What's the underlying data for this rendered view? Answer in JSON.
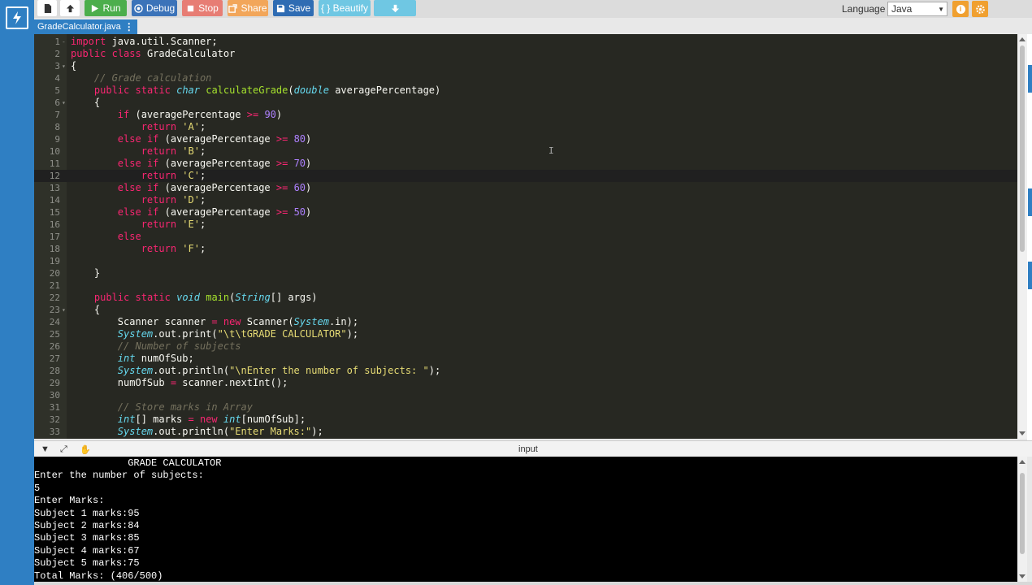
{
  "toolbar": {
    "run_label": "Run",
    "debug_label": "Debug",
    "stop_label": "Stop",
    "share_label": "Share",
    "save_label": "Save",
    "beautify_label": "{ } Beautify",
    "language_label": "Language",
    "language_value": "Java"
  },
  "tab": {
    "filename": "GradeCalculator.java"
  },
  "editor": {
    "active_line": 12,
    "lines": [
      [
        [
          "kw",
          "import"
        ],
        [
          "",
          "java.util.Scanner;"
        ]
      ],
      [
        [
          "kw",
          "public"
        ],
        [
          "",
          ""
        ],
        [
          "kw",
          "class"
        ],
        [
          "",
          " GradeCalculator"
        ]
      ],
      [
        [
          "",
          "{"
        ]
      ],
      [
        [
          "",
          "    "
        ],
        [
          "cm",
          "// Grade calculation"
        ]
      ],
      [
        [
          "",
          "    "
        ],
        [
          "kw",
          "public"
        ],
        [
          "",
          " "
        ],
        [
          "kw",
          "static"
        ],
        [
          "",
          " "
        ],
        [
          "ty",
          "char"
        ],
        [
          "",
          " "
        ],
        [
          "fn",
          "calculateGrade"
        ],
        [
          "",
          "("
        ],
        [
          "ty",
          "double"
        ],
        [
          "",
          " averagePercentage)"
        ]
      ],
      [
        [
          "",
          "    {"
        ]
      ],
      [
        [
          "",
          "        "
        ],
        [
          "kw",
          "if"
        ],
        [
          "",
          " (averagePercentage "
        ],
        [
          "sy",
          ">="
        ],
        [
          "",
          " "
        ],
        [
          "nu",
          "90"
        ],
        [
          "",
          ")"
        ]
      ],
      [
        [
          "",
          "            "
        ],
        [
          "kw",
          "return"
        ],
        [
          "",
          " "
        ],
        [
          "st",
          "'A'"
        ],
        [
          "",
          ";"
        ]
      ],
      [
        [
          "",
          "        "
        ],
        [
          "kw",
          "else"
        ],
        [
          "",
          " "
        ],
        [
          "kw",
          "if"
        ],
        [
          "",
          " (averagePercentage "
        ],
        [
          "sy",
          ">="
        ],
        [
          "",
          " "
        ],
        [
          "nu",
          "80"
        ],
        [
          "",
          ")"
        ]
      ],
      [
        [
          "",
          "            "
        ],
        [
          "kw",
          "return"
        ],
        [
          "",
          " "
        ],
        [
          "st",
          "'B'"
        ],
        [
          "",
          ";"
        ]
      ],
      [
        [
          "",
          "        "
        ],
        [
          "kw",
          "else"
        ],
        [
          "",
          " "
        ],
        [
          "kw",
          "if"
        ],
        [
          "",
          " (averagePercentage "
        ],
        [
          "sy",
          ">="
        ],
        [
          "",
          " "
        ],
        [
          "nu",
          "70"
        ],
        [
          "",
          ")"
        ]
      ],
      [
        [
          "",
          "            "
        ],
        [
          "kw",
          "return"
        ],
        [
          "",
          " "
        ],
        [
          "st",
          "'C'"
        ],
        [
          "",
          ";"
        ]
      ],
      [
        [
          "",
          "        "
        ],
        [
          "kw",
          "else"
        ],
        [
          "",
          " "
        ],
        [
          "kw",
          "if"
        ],
        [
          "",
          " (averagePercentage "
        ],
        [
          "sy",
          ">="
        ],
        [
          "",
          " "
        ],
        [
          "nu",
          "60"
        ],
        [
          "",
          ")"
        ]
      ],
      [
        [
          "",
          "            "
        ],
        [
          "kw",
          "return"
        ],
        [
          "",
          " "
        ],
        [
          "st",
          "'D'"
        ],
        [
          "",
          ";"
        ]
      ],
      [
        [
          "",
          "        "
        ],
        [
          "kw",
          "else"
        ],
        [
          "",
          " "
        ],
        [
          "kw",
          "if"
        ],
        [
          "",
          " (averagePercentage "
        ],
        [
          "sy",
          ">="
        ],
        [
          "",
          " "
        ],
        [
          "nu",
          "50"
        ],
        [
          "",
          ")"
        ]
      ],
      [
        [
          "",
          "            "
        ],
        [
          "kw",
          "return"
        ],
        [
          "",
          " "
        ],
        [
          "st",
          "'E'"
        ],
        [
          "",
          ";"
        ]
      ],
      [
        [
          "",
          "        "
        ],
        [
          "kw",
          "else"
        ]
      ],
      [
        [
          "",
          "            "
        ],
        [
          "kw",
          "return"
        ],
        [
          "",
          " "
        ],
        [
          "st",
          "'F'"
        ],
        [
          "",
          ";"
        ]
      ],
      [
        [
          "",
          ""
        ]
      ],
      [
        [
          "",
          "    }"
        ]
      ],
      [
        [
          "",
          ""
        ]
      ],
      [
        [
          "",
          "    "
        ],
        [
          "kw",
          "public"
        ],
        [
          "",
          " "
        ],
        [
          "kw",
          "static"
        ],
        [
          "",
          " "
        ],
        [
          "ty",
          "void"
        ],
        [
          "",
          " "
        ],
        [
          "fn",
          "main"
        ],
        [
          "",
          "("
        ],
        [
          "ty",
          "String"
        ],
        [
          "",
          "[] args)"
        ]
      ],
      [
        [
          "",
          "    {"
        ]
      ],
      [
        [
          "",
          "        Scanner scanner "
        ],
        [
          "sy",
          "="
        ],
        [
          "",
          " "
        ],
        [
          "kw",
          "new"
        ],
        [
          "",
          " Scanner("
        ],
        [
          "ty",
          "System"
        ],
        [
          "",
          ".in);"
        ]
      ],
      [
        [
          "",
          "        "
        ],
        [
          "ty",
          "System"
        ],
        [
          "",
          ".out.print("
        ],
        [
          "st",
          "\"\\t\\tGRADE CALCULATOR\""
        ],
        [
          "",
          ");"
        ]
      ],
      [
        [
          "",
          "        "
        ],
        [
          "cm",
          "// Number of subjects"
        ]
      ],
      [
        [
          "",
          "        "
        ],
        [
          "ty",
          "int"
        ],
        [
          "",
          " numOfSub;"
        ]
      ],
      [
        [
          "",
          "        "
        ],
        [
          "ty",
          "System"
        ],
        [
          "",
          ".out.println("
        ],
        [
          "st",
          "\"\\nEnter the number of subjects: \""
        ],
        [
          "",
          ");"
        ]
      ],
      [
        [
          "",
          "        numOfSub "
        ],
        [
          "sy",
          "="
        ],
        [
          "",
          " scanner.nextInt();"
        ]
      ],
      [
        [
          "",
          ""
        ]
      ],
      [
        [
          "",
          "        "
        ],
        [
          "cm",
          "// Store marks in Array"
        ]
      ],
      [
        [
          "",
          "        "
        ],
        [
          "ty",
          "int"
        ],
        [
          "",
          "[] marks "
        ],
        [
          "sy",
          "="
        ],
        [
          "",
          " "
        ],
        [
          "kw",
          "new"
        ],
        [
          "",
          " "
        ],
        [
          "ty",
          "int"
        ],
        [
          "",
          "[numOfSub];"
        ]
      ],
      [
        [
          "",
          "        "
        ],
        [
          "ty",
          "System"
        ],
        [
          "",
          ".out.println("
        ],
        [
          "st",
          "\"Enter Marks:\""
        ],
        [
          "",
          ");"
        ]
      ]
    ]
  },
  "console": {
    "title": "input",
    "lines": [
      "                GRADE CALCULATOR",
      "Enter the number of subjects:",
      "5",
      "Enter Marks:",
      "Subject 1 marks:95",
      "Subject 2 marks:84",
      "Subject 3 marks:85",
      "Subject 4 marks:67",
      "Subject 5 marks:75",
      "Total Marks: (406/500)"
    ]
  },
  "colors": {
    "brand": "#2f7fc3",
    "run": "#4cae4c",
    "debug": "#3b73b9",
    "stop": "#e77d74",
    "share": "#f2a65a",
    "save": "#2f6cb3",
    "beautify": "#6fc7e3",
    "editor_bg": "#272822"
  },
  "icons": [
    "bolt-icon",
    "new-file-icon",
    "upload-icon",
    "play-icon",
    "debug-icon",
    "stop-icon",
    "share-icon",
    "save-icon",
    "download-icon",
    "info-icon",
    "gear-icon",
    "chevron-down-icon",
    "expand-icon",
    "hand-icon"
  ]
}
